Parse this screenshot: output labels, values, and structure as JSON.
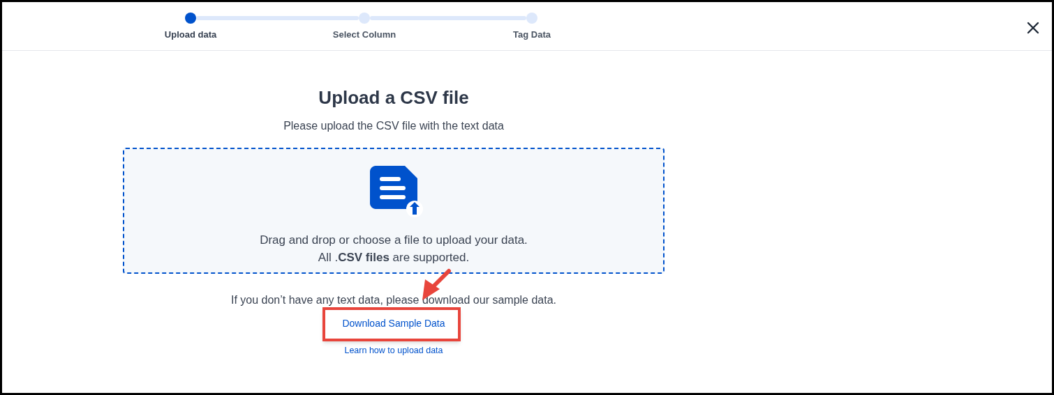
{
  "steps": [
    {
      "label": "Upload data",
      "selected": true
    },
    {
      "label": "Select Column",
      "selected": false
    },
    {
      "label": "Tag Data",
      "selected": false
    }
  ],
  "upload": {
    "title": "Upload a CSV file",
    "subtitle": "Please upload the CSV file with the text data",
    "dropzone": {
      "line_1": "Drag and drop or choose a file to upload your data.",
      "line_2": "All .**CSV files** are supported."
    },
    "hint": "If you don’t have any text data, please download our sample data.",
    "download_link": "Download Sample Data",
    "learn_link": "Learn how to upload data"
  }
}
